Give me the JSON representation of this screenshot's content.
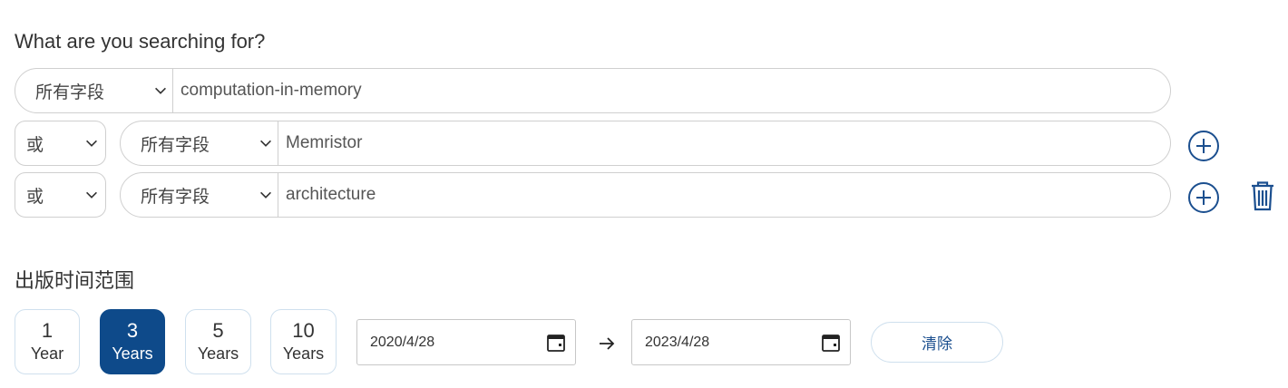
{
  "search": {
    "heading": "What are you searching for?",
    "rows": [
      {
        "field": "所有字段",
        "term": "computation-in-memory"
      },
      {
        "operator": "或",
        "field": "所有字段",
        "term": "Memristor"
      },
      {
        "operator": "或",
        "field": "所有字段",
        "term": "architecture"
      }
    ]
  },
  "date_range": {
    "heading": "出版时间范围",
    "presets": [
      {
        "number": "1",
        "unit": "Year",
        "active": false
      },
      {
        "number": "3",
        "unit": "Years",
        "active": true
      },
      {
        "number": "5",
        "unit": "Years",
        "active": false
      },
      {
        "number": "10",
        "unit": "Years",
        "active": false
      }
    ],
    "start_date": "2020/4/28",
    "end_date": "2023/4/28",
    "clear_label": "清除"
  },
  "icons": {
    "add_row": "plus-circle-icon",
    "delete_row": "trash-icon",
    "calendar": "calendar-icon",
    "arrow": "arrow-right-icon",
    "dropdown": "chevron-down-icon"
  },
  "colors": {
    "accent": "#1b4f8f",
    "active_button": "#0e4a8a",
    "border": "#cfcfcf"
  }
}
